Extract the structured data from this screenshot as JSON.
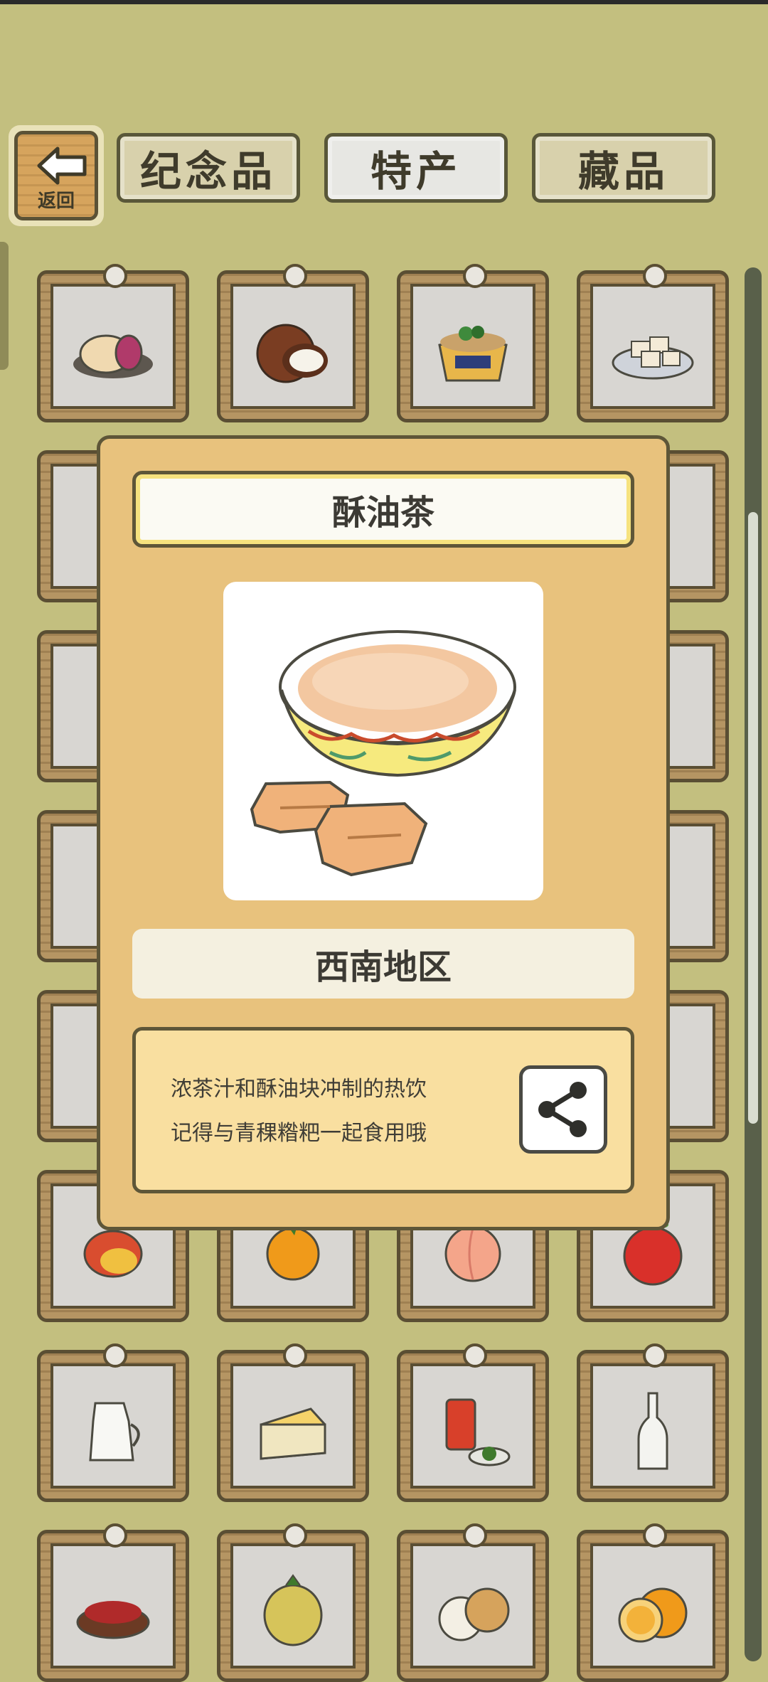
{
  "header": {
    "back_label": "返回",
    "tabs": [
      {
        "label": "纪念品",
        "active": false
      },
      {
        "label": "特产",
        "active": true
      },
      {
        "label": "藏品",
        "active": false
      }
    ]
  },
  "modal": {
    "title": "酥油茶",
    "region": "西南地区",
    "description_line1": "浓茶汁和酥油块冲制的热饮",
    "description_line2": "记得与青稞糌粑一起食用哦",
    "image_icon": "butter-tea-bowl-with-tsampa"
  },
  "grid_items": [
    "mooncake",
    "coconut",
    "noodle-bowl",
    "tofu-plate",
    "hidden",
    "hidden",
    "hidden",
    "hidden",
    "hidden",
    "hidden",
    "hidden",
    "hidden",
    "hidden",
    "hidden",
    "hidden",
    "hidden",
    "hidden",
    "hidden",
    "hidden",
    "hidden",
    "mango",
    "orange",
    "peach",
    "apple",
    "milk-jug",
    "cheese",
    "tea-can",
    "bottle",
    "goji",
    "durian",
    "longan",
    "orange-slices"
  ],
  "colors": {
    "background": "#c3bf7f",
    "modal_bg": "#e8c27d",
    "frame": "#5e5638"
  }
}
